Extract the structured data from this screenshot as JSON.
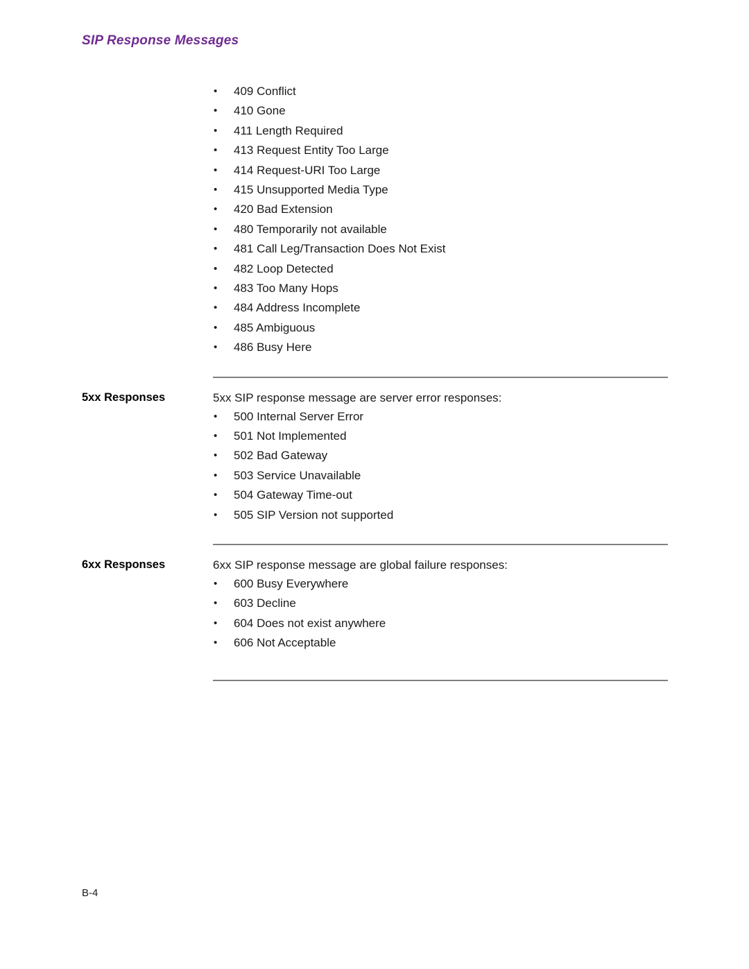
{
  "header": {
    "running_title": "SIP Response Messages",
    "accent_color": "#6f2b91"
  },
  "footer": {
    "page_number": "B-4"
  },
  "rule_color": "#808080",
  "sections": [
    {
      "id": "4xx-continued",
      "label": "",
      "intro": "",
      "has_rule_above": false,
      "items": [
        "409 Conflict",
        "410 Gone",
        "411 Length Required",
        "413 Request Entity Too Large",
        "414 Request-URI Too Large",
        "415 Unsupported Media Type",
        "420 Bad Extension",
        "480 Temporarily not available",
        "481 Call Leg/Transaction Does Not Exist",
        "482 Loop Detected",
        "483 Too Many Hops",
        "484 Address Incomplete",
        "485 Ambiguous",
        "486 Busy Here"
      ]
    },
    {
      "id": "5xx",
      "label": "5xx Responses",
      "intro": "5xx SIP response message are server error responses:",
      "has_rule_above": true,
      "items": [
        "500 Internal Server Error",
        "501 Not Implemented",
        "502 Bad Gateway",
        "503 Service Unavailable",
        "504 Gateway Time-out",
        "505 SIP Version not supported"
      ]
    },
    {
      "id": "6xx",
      "label": "6xx Responses",
      "intro": "6xx SIP response message are global failure responses:",
      "has_rule_above": true,
      "items": [
        "600 Busy Everywhere",
        "603 Decline",
        "604 Does not exist anywhere",
        "606 Not Acceptable"
      ]
    }
  ],
  "bullet_glyph": "•"
}
